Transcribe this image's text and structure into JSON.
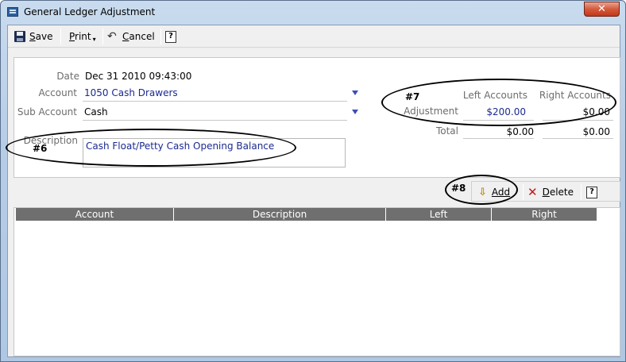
{
  "window": {
    "title": "General Ledger Adjustment",
    "close_glyph": "✕"
  },
  "toolbar": {
    "save_label": "Save",
    "print_label": "Print",
    "cancel_label": "Cancel",
    "help_glyph": "?"
  },
  "form": {
    "date_label": "Date",
    "date_value": "Dec 31 2010 09:43:00",
    "account_label": "Account",
    "account_value": "1050 Cash Drawers",
    "subaccount_label": "Sub Account",
    "subaccount_value": "Cash",
    "description_label": "Description",
    "description_value": "Cash Float/Petty Cash Opening Balance"
  },
  "totals": {
    "left_header": "Left Accounts",
    "right_header": "Right Accounts",
    "adjustment_label": "Adjustment",
    "adjustment_left": "$200.00",
    "adjustment_right": "$0.00",
    "total_label": "Total",
    "total_left": "$0.00",
    "total_right": "$0.00"
  },
  "grid_toolbar": {
    "add_label": "Add",
    "delete_label": "Delete",
    "help_glyph": "?"
  },
  "grid": {
    "columns": [
      "Account",
      "Description",
      "Left",
      "Right"
    ]
  },
  "annotations": {
    "a6": "#6",
    "a7": "#7",
    "a8": "#8"
  },
  "icons": [
    "save-icon",
    "chevron-down-icon",
    "undo-icon",
    "help-icon",
    "arrow-down-icon",
    "delete-x-icon"
  ]
}
